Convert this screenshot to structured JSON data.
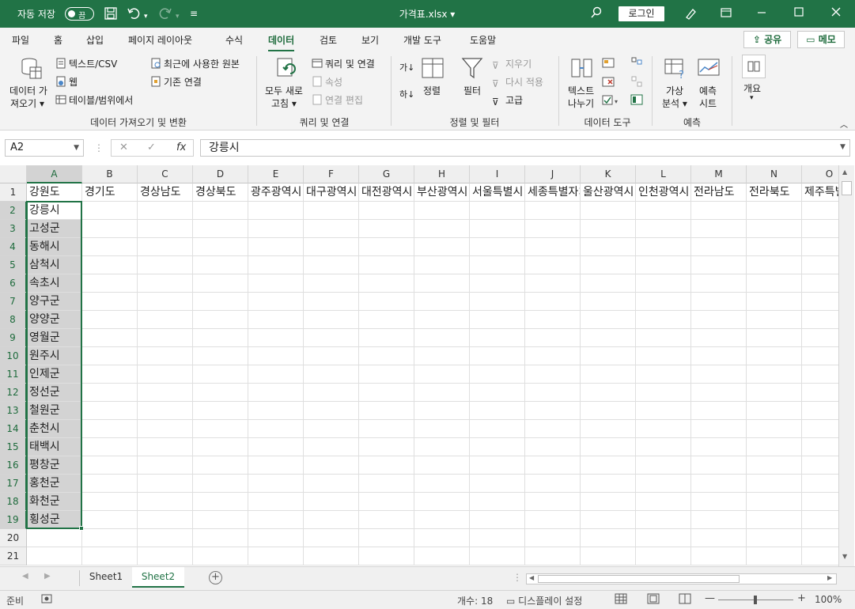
{
  "titlebar": {
    "autosave_label": "자동 저장",
    "autosave_state": "끔",
    "document_title": "가격표.xlsx",
    "login_label": "로그인"
  },
  "ribbon_tabs": [
    "파일",
    "홈",
    "삽입",
    "페이지 레이아웃",
    "수식",
    "데이터",
    "검토",
    "보기",
    "개발 도구",
    "도움말"
  ],
  "active_tab": "데이터",
  "share_label": "공유",
  "memo_label": "메모",
  "ribbon": {
    "get_data": {
      "label": "데이터 가져오기 및 변환",
      "get_data_l1": "데이터 가",
      "get_data_l2": "져오기",
      "text_csv": "텍스트/CSV",
      "web": "웹",
      "table_range": "테이블/범위에서",
      "recent_sources": "최근에 사용한 원본",
      "existing_connections": "기존 연결"
    },
    "queries": {
      "label": "쿼리 및 연결",
      "refresh_l1": "모두 새로",
      "refresh_l2": "고침",
      "queries_connections": "쿼리 및 연결",
      "properties": "속성",
      "edit_links": "연결 편집"
    },
    "sort_filter": {
      "label": "정렬 및 필터",
      "sort": "정렬",
      "filter": "필터",
      "clear": "지우기",
      "reapply": "다시 적용",
      "advanced": "고급"
    },
    "data_tools": {
      "label": "데이터 도구",
      "text_to_columns_l1": "텍스트",
      "text_to_columns_l2": "나누기"
    },
    "forecast": {
      "label": "예측",
      "what_if_l1": "가상",
      "what_if_l2": "분석",
      "forecast_l1": "예측",
      "forecast_l2": "시트"
    },
    "outline": {
      "label": "개요"
    }
  },
  "formula_bar": {
    "name_box": "A2",
    "fx": "fx",
    "formula": "강릉시"
  },
  "columns": [
    "A",
    "B",
    "C",
    "D",
    "E",
    "F",
    "G",
    "H",
    "I",
    "J",
    "K",
    "L",
    "M",
    "N",
    "O"
  ],
  "rows": [
    "1",
    "2",
    "3",
    "4",
    "5",
    "6",
    "7",
    "8",
    "9",
    "10",
    "11",
    "12",
    "13",
    "14",
    "15",
    "16",
    "17",
    "18",
    "19",
    "20",
    "21"
  ],
  "header_row": [
    "강원도",
    "경기도",
    "경상남도",
    "경상북도",
    "광주광역시",
    "대구광역시",
    "대전광역시",
    "부산광역시",
    "서울특별시",
    "세종특별자치시",
    "울산광역시",
    "인천광역시",
    "전라남도",
    "전라북도",
    "제주특별자치도"
  ],
  "column_a_values": [
    "강릉시",
    "고성군",
    "동해시",
    "삼척시",
    "속초시",
    "양구군",
    "양양군",
    "영월군",
    "원주시",
    "인제군",
    "정선군",
    "철원군",
    "춘천시",
    "태백시",
    "평창군",
    "홍천군",
    "화천군",
    "횡성군"
  ],
  "sheets": [
    "Sheet1",
    "Sheet2"
  ],
  "active_sheet": "Sheet2",
  "status": {
    "ready": "준비",
    "count": "개수: 18",
    "display_settings": "디스플레이 설정",
    "zoom": "100%"
  },
  "colors": {
    "accent": "#217346",
    "selection_fill": "#d3d3d3"
  }
}
